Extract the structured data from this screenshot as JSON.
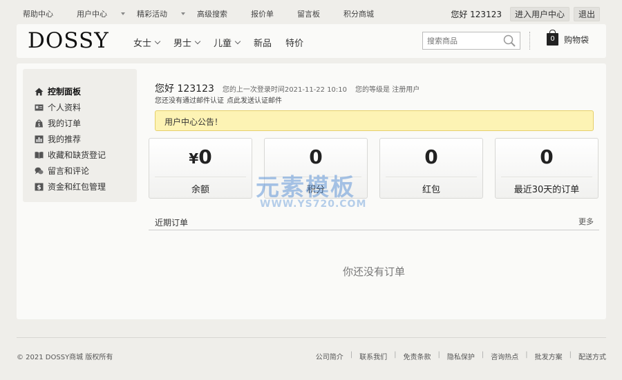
{
  "topbar": {
    "links": [
      {
        "label": "帮助中心",
        "caret": false
      },
      {
        "label": "用户中心",
        "caret": true
      },
      {
        "label": "精彩活动",
        "caret": true
      },
      {
        "label": "高级搜索",
        "caret": false
      },
      {
        "label": "报价单",
        "caret": false
      },
      {
        "label": "留言板",
        "caret": false
      },
      {
        "label": "积分商城",
        "caret": false
      }
    ],
    "greeting": "您好 123123",
    "enter_center_label": "进入用户中心",
    "logout_label": "退出"
  },
  "header": {
    "logo": "DOSSY",
    "nav": [
      "女士",
      "男士",
      "儿童",
      "新品",
      "特价"
    ],
    "search_placeholder": "搜索商品",
    "cart_count": "0",
    "cart_label": "购物袋"
  },
  "sidebar": {
    "items": [
      {
        "label": "控制面板",
        "icon": "home-icon"
      },
      {
        "label": "个人资料",
        "icon": "id-card-icon"
      },
      {
        "label": "我的订单",
        "icon": "shopping-bag-icon"
      },
      {
        "label": "我的推荐",
        "icon": "bar-chart-icon"
      },
      {
        "label": "收藏和缺货登记",
        "icon": "book-icon"
      },
      {
        "label": "留言和评论",
        "icon": "chat-icon"
      },
      {
        "label": "资金和红包管理",
        "icon": "money-icon"
      }
    ]
  },
  "welcome": {
    "hello": "您好 123123",
    "last_login": "您的上一次登录时间2021-11-22 10:10",
    "level": "您的等级是 注册用户",
    "verify_text": "您还没有通过邮件认证",
    "verify_link": "点此发送认证邮件"
  },
  "notice": "用户中心公告！",
  "cards": [
    {
      "prefix": "¥",
      "value": "0",
      "label": "余额"
    },
    {
      "prefix": "",
      "value": "0",
      "label": "积分"
    },
    {
      "prefix": "",
      "value": "0",
      "label": "红包"
    },
    {
      "prefix": "",
      "value": "0",
      "label": "最近30天的订单"
    }
  ],
  "watermark": {
    "text": "元素模板",
    "url": "WWW.YS720.COM"
  },
  "orders": {
    "title": "近期订单",
    "more": "更多",
    "empty": "你还没有订单"
  },
  "footer": {
    "copyright": "© 2021 DOSSY商城 版权所有",
    "links": [
      "公司简介",
      "联系我们",
      "免责条款",
      "隐私保护",
      "咨询热点",
      "批发方案",
      "配送方式"
    ]
  }
}
